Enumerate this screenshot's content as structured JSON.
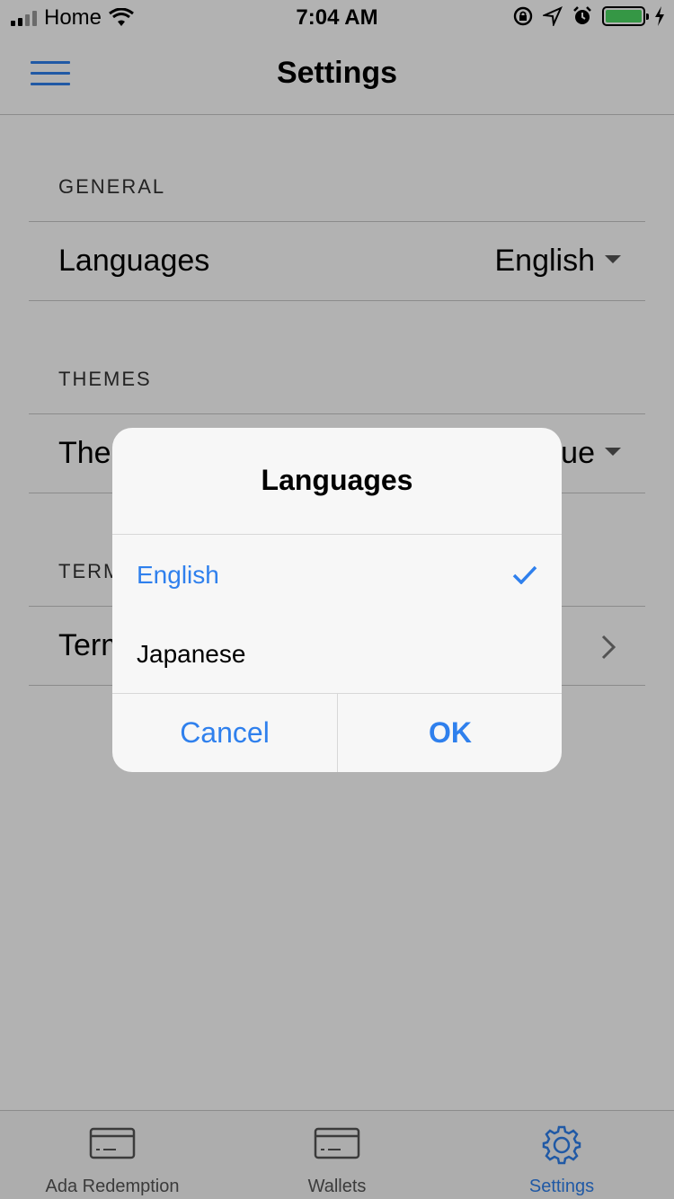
{
  "status_bar": {
    "carrier": "Home",
    "time": "7:04 AM",
    "battery_color": "#4cd964"
  },
  "header": {
    "title": "Settings",
    "menu_icon": "hamburger-icon"
  },
  "sections": {
    "general": {
      "title": "GENERAL",
      "row_label": "Languages",
      "row_value": "English"
    },
    "themes": {
      "title": "THEMES",
      "row_label_visible": "The",
      "row_value_visible": "ue"
    },
    "terms": {
      "title_visible": "TERM",
      "row_label_visible": "Term"
    }
  },
  "dialog": {
    "title": "Languages",
    "options": [
      {
        "label": "English",
        "selected": true
      },
      {
        "label": "Japanese",
        "selected": false
      }
    ],
    "cancel_label": "Cancel",
    "ok_label": "OK"
  },
  "tabbar": {
    "tabs": [
      {
        "label": "Ada Redemption",
        "icon": "card-icon",
        "active": false
      },
      {
        "label": "Wallets",
        "icon": "card-icon",
        "active": false
      },
      {
        "label": "Settings",
        "icon": "gear-icon",
        "active": true
      }
    ]
  },
  "colors": {
    "accent": "#2f80ed",
    "overlay": "rgba(0,0,0,0.3)"
  }
}
